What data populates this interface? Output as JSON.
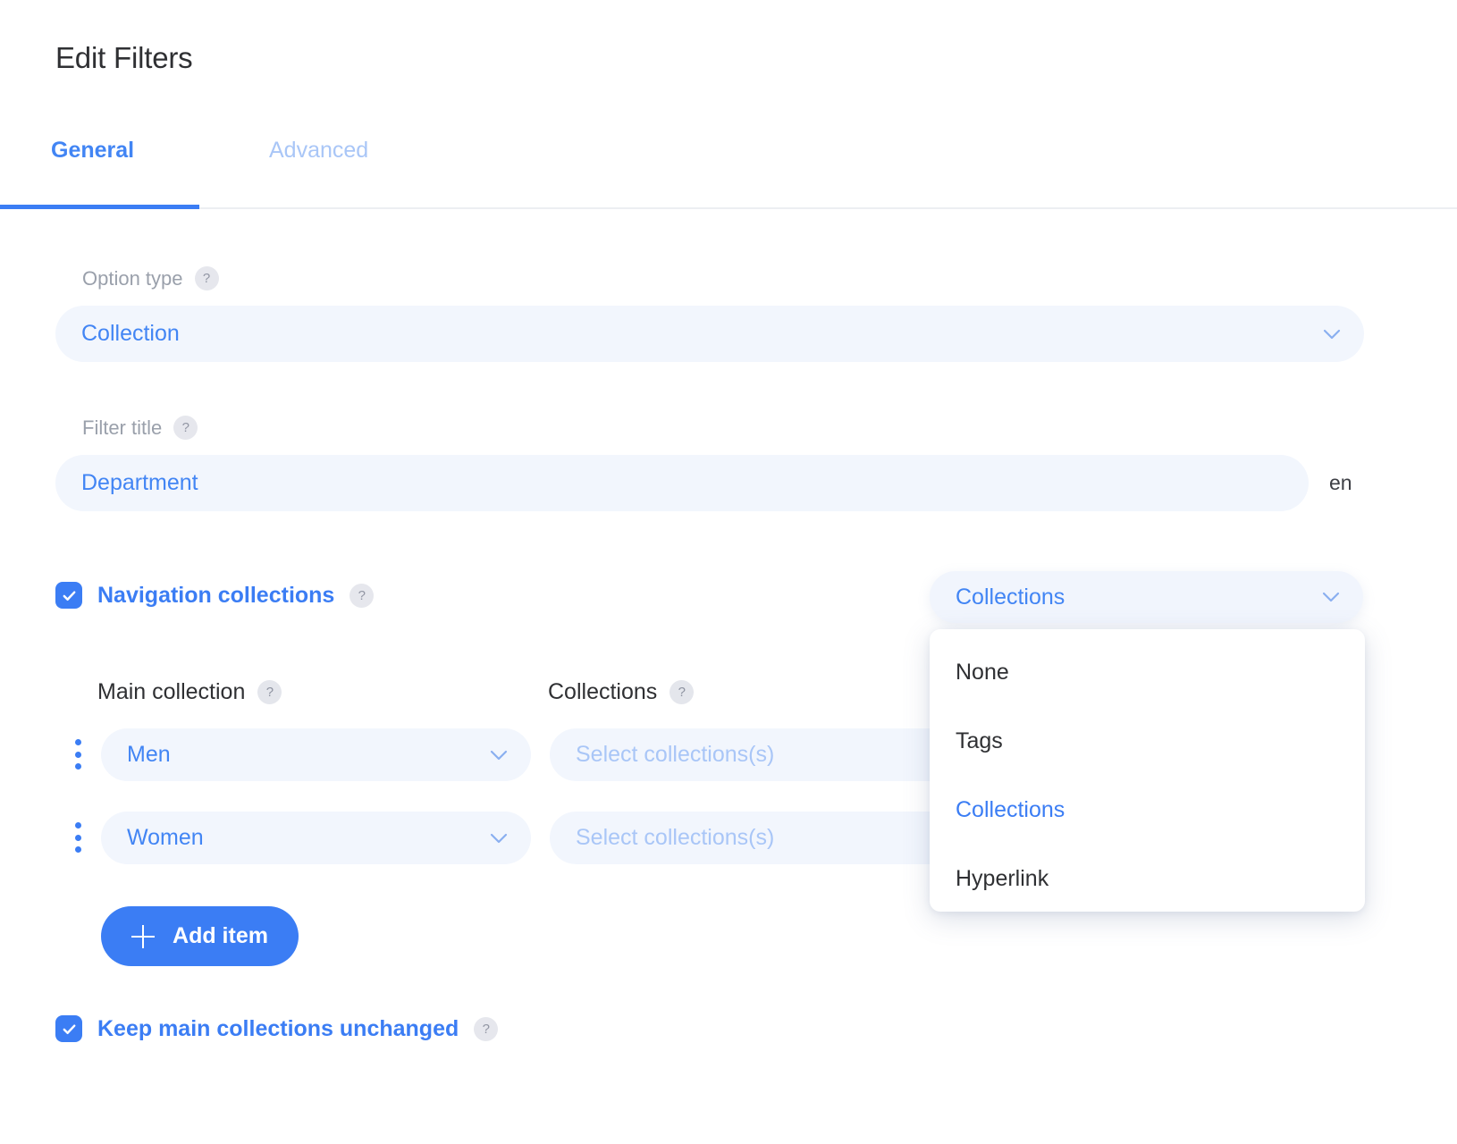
{
  "page_title": "Edit Filters",
  "tabs": [
    {
      "label": "General",
      "active": true
    },
    {
      "label": "Advanced",
      "active": false
    }
  ],
  "help_glyph": "?",
  "fields": {
    "option_type": {
      "label": "Option type",
      "value": "Collection",
      "icon": "chevron-down-icon"
    },
    "filter_title": {
      "label": "Filter title",
      "value": "Department",
      "lang_code": "en"
    }
  },
  "navigation_collections": {
    "label": "Navigation collections",
    "checked": true,
    "columns": {
      "main": "Main collection",
      "collections": "Collections"
    },
    "rows": [
      {
        "main_collection": "Men",
        "collections_placeholder": "Select collections(s)"
      },
      {
        "main_collection": "Women",
        "collections_placeholder": "Select collections(s)"
      }
    ],
    "add_item_label": "Add item"
  },
  "keep_main_collections": {
    "label": "Keep main collections unchanged",
    "checked": true
  },
  "type_select": {
    "value": "Collections",
    "options": [
      {
        "label": "None",
        "selected": false
      },
      {
        "label": "Tags",
        "selected": false
      },
      {
        "label": "Collections",
        "selected": true
      },
      {
        "label": "Hyperlink",
        "selected": false
      }
    ]
  },
  "colors": {
    "accent": "#3b7df4",
    "accent_text": "#4285f4",
    "muted_blue": "#a9c6f7",
    "field_bg": "#f2f6fd",
    "label_gray": "#9aa0ab",
    "text_dark": "#2f3033"
  }
}
